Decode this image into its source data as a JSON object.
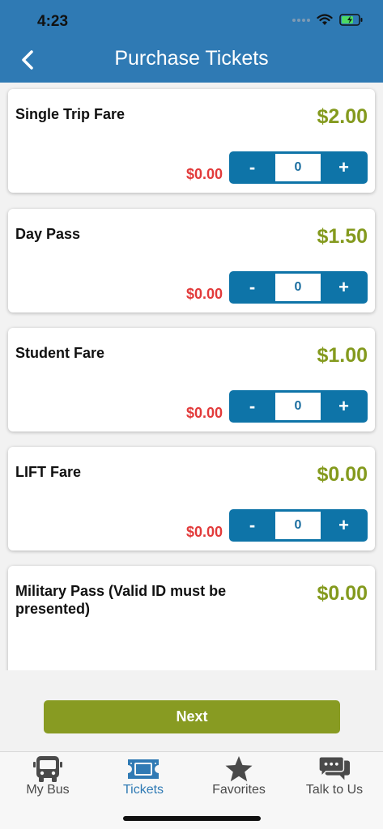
{
  "status": {
    "time": "4:23"
  },
  "header": {
    "title": "Purchase Tickets"
  },
  "tickets": [
    {
      "name": "Single Trip Fare",
      "price": "$2.00",
      "subtotal": "$0.00",
      "quantity": "0"
    },
    {
      "name": "Day Pass",
      "price": "$1.50",
      "subtotal": "$0.00",
      "quantity": "0"
    },
    {
      "name": "Student Fare",
      "price": "$1.00",
      "subtotal": "$0.00",
      "quantity": "0"
    },
    {
      "name": "LIFT Fare",
      "price": "$0.00",
      "subtotal": "$0.00",
      "quantity": "0"
    },
    {
      "name": "Military Pass (Valid ID must be presented)",
      "price": "$0.00"
    }
  ],
  "stepper": {
    "minus": "-",
    "plus": "+"
  },
  "footer": {
    "next_label": "Next"
  },
  "tabs": [
    {
      "label": "My Bus",
      "icon": "bus-icon"
    },
    {
      "label": "Tickets",
      "icon": "ticket-icon"
    },
    {
      "label": "Favorites",
      "icon": "star-icon"
    },
    {
      "label": "Talk to Us",
      "icon": "chat-icon"
    }
  ],
  "colors": {
    "header": "#2f7ab4",
    "price": "#849a1e",
    "subtotal": "#e23b3b",
    "stepper": "#0e74a8",
    "next": "#889b22"
  }
}
